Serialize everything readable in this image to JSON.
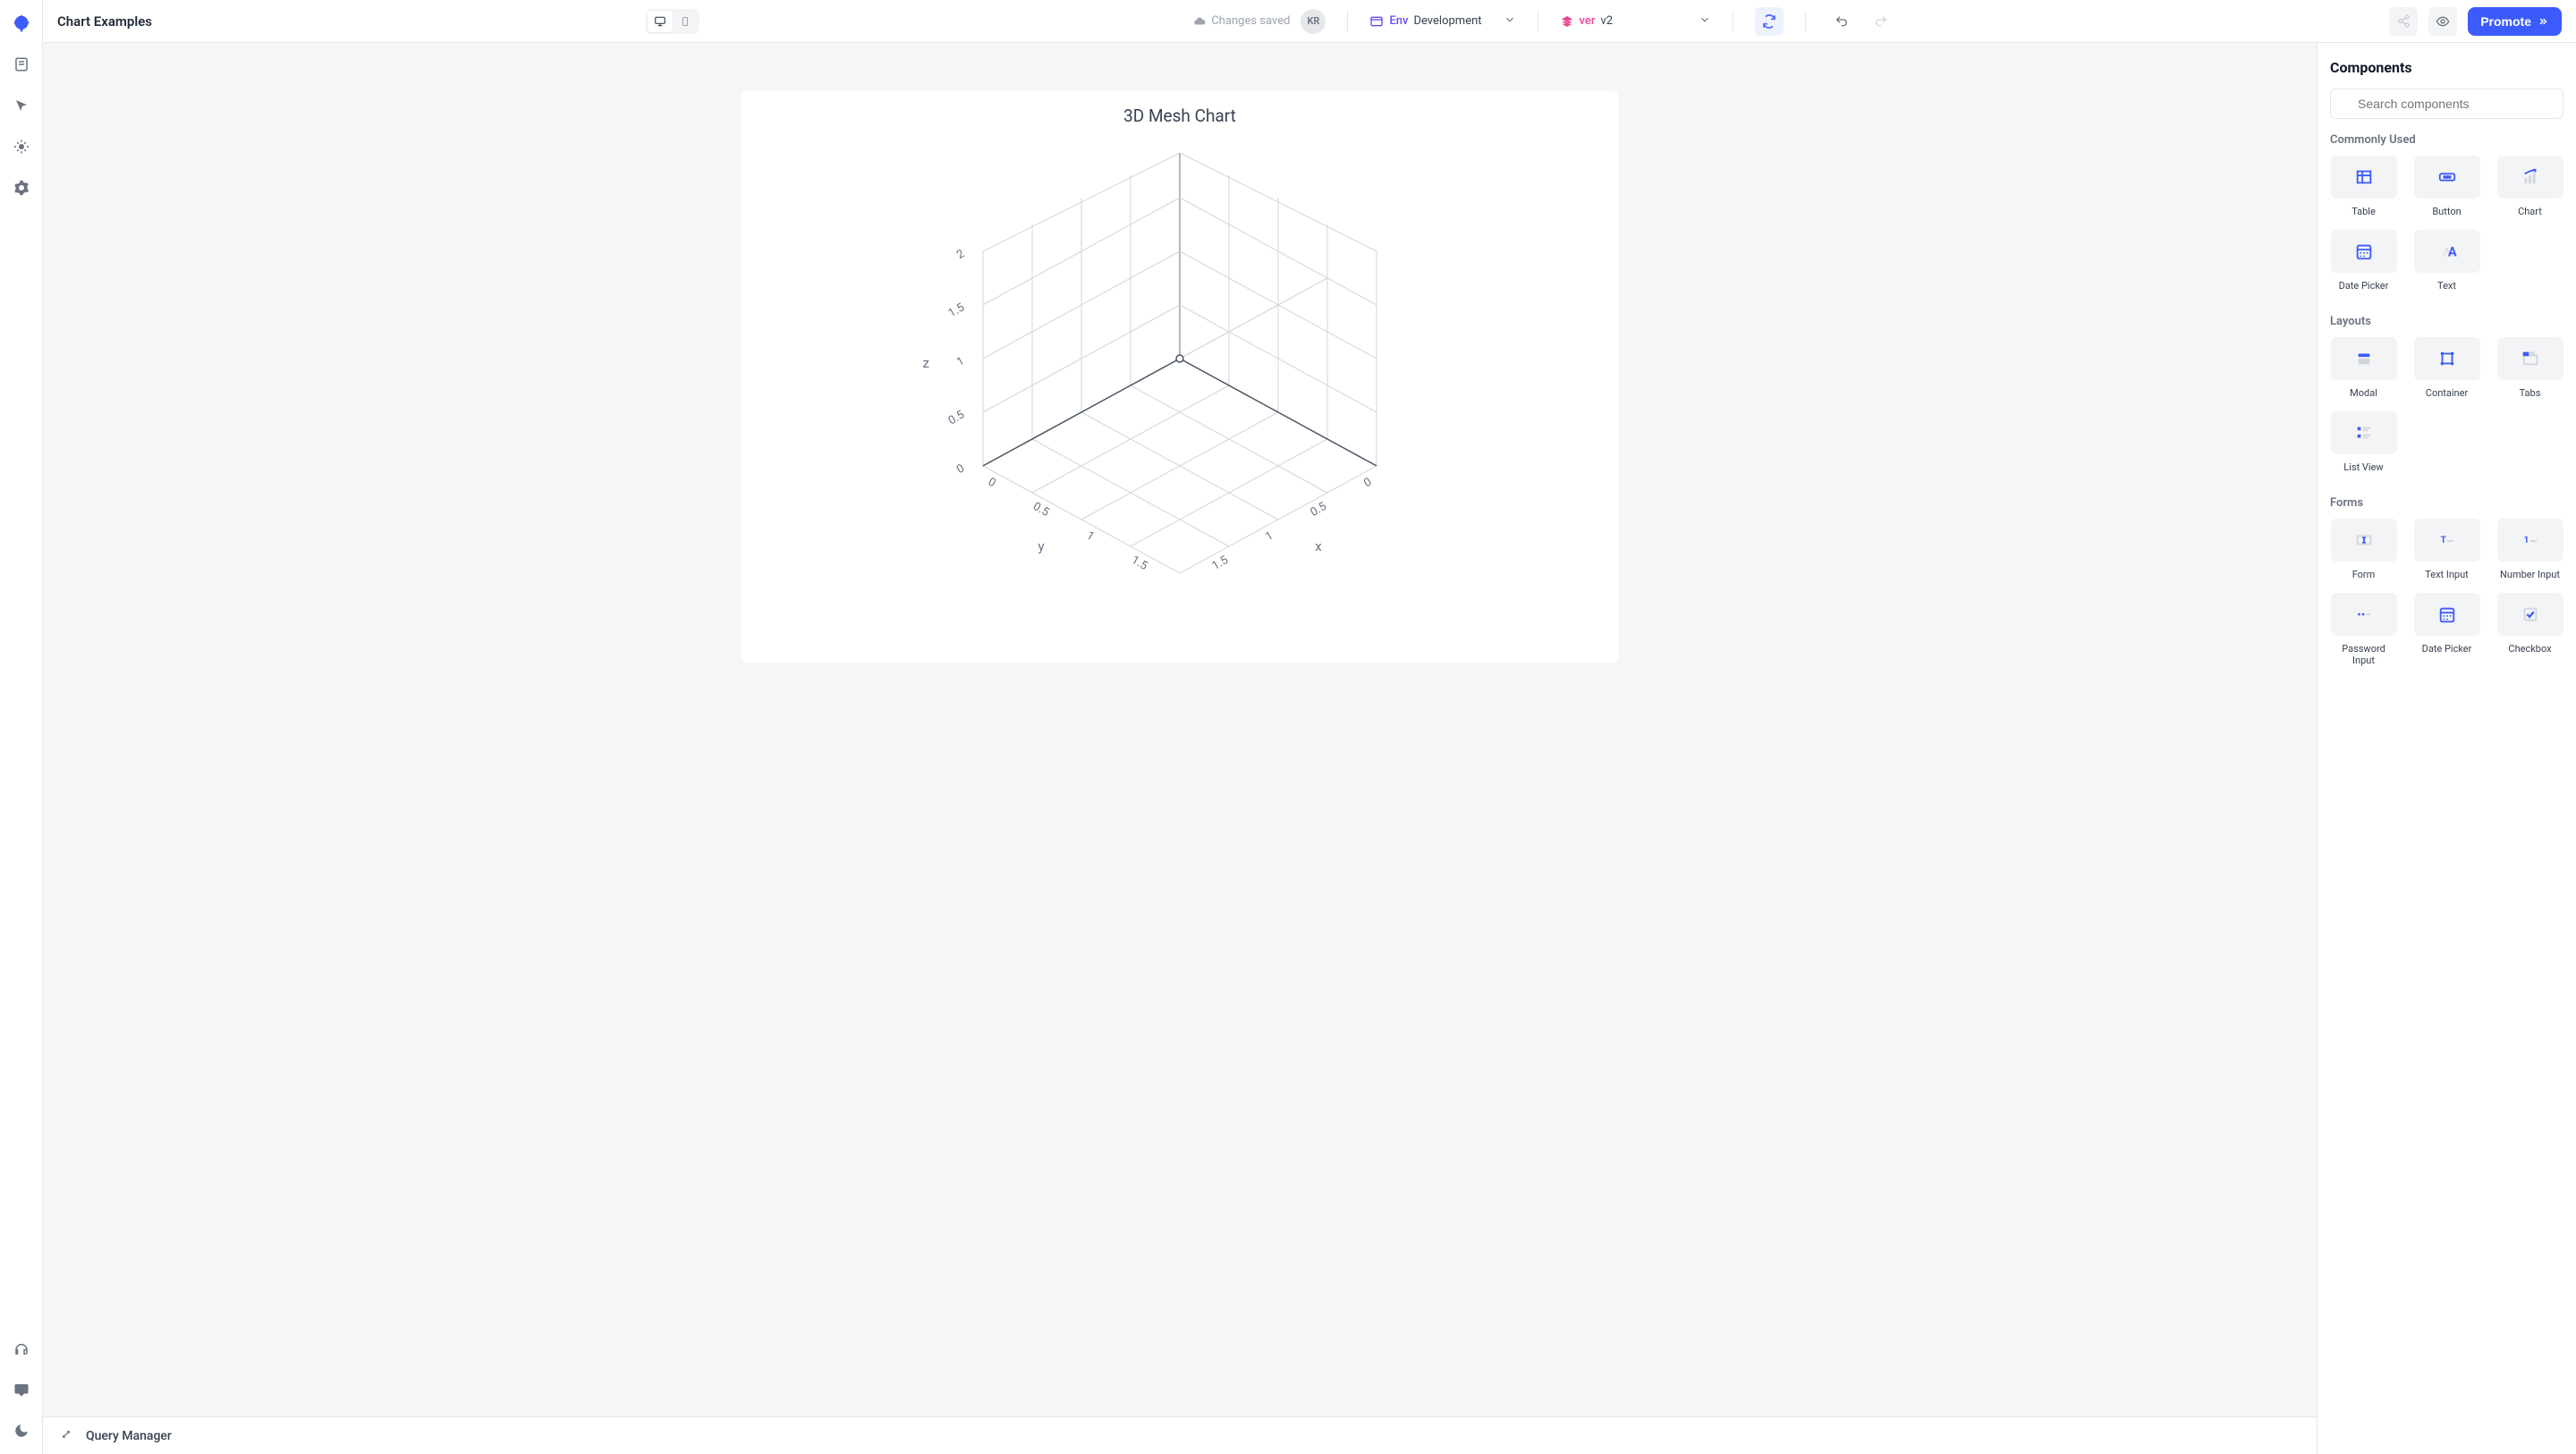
{
  "header": {
    "title": "Chart Examples",
    "saved_label": "Changes saved",
    "avatar_initials": "KR",
    "env_label": "Env",
    "env_value": "Development",
    "ver_label": "ver",
    "ver_value": "v2",
    "promote_label": "Promote"
  },
  "right_panel": {
    "title": "Components",
    "search_placeholder": "Search components",
    "sections": {
      "commonly_used": {
        "label": "Commonly Used",
        "items": [
          "Table",
          "Button",
          "Chart",
          "Date Picker",
          "Text"
        ]
      },
      "layouts": {
        "label": "Layouts",
        "items": [
          "Modal",
          "Container",
          "Tabs",
          "List View"
        ]
      },
      "forms": {
        "label": "Forms",
        "items": [
          "Form",
          "Text Input",
          "Number Input",
          "Password Input",
          "Date Picker",
          "Checkbox"
        ]
      }
    }
  },
  "canvas": {
    "chart_title": "3D Mesh Chart"
  },
  "footer": {
    "query_manager_label": "Query Manager"
  },
  "chart_data": {
    "type": "3d-mesh",
    "title": "3D Mesh Chart",
    "axes": {
      "x": {
        "label": "x",
        "ticks": [
          0,
          0.5,
          1,
          1.5
        ],
        "range": [
          0,
          1.5
        ]
      },
      "y": {
        "label": "y",
        "ticks": [
          0,
          0.5,
          1,
          1.5
        ],
        "range": [
          0,
          1.5
        ]
      },
      "z": {
        "label": "z",
        "ticks": [
          0,
          0.5,
          1,
          1.5,
          2
        ],
        "range": [
          0,
          2
        ]
      }
    },
    "series": []
  }
}
